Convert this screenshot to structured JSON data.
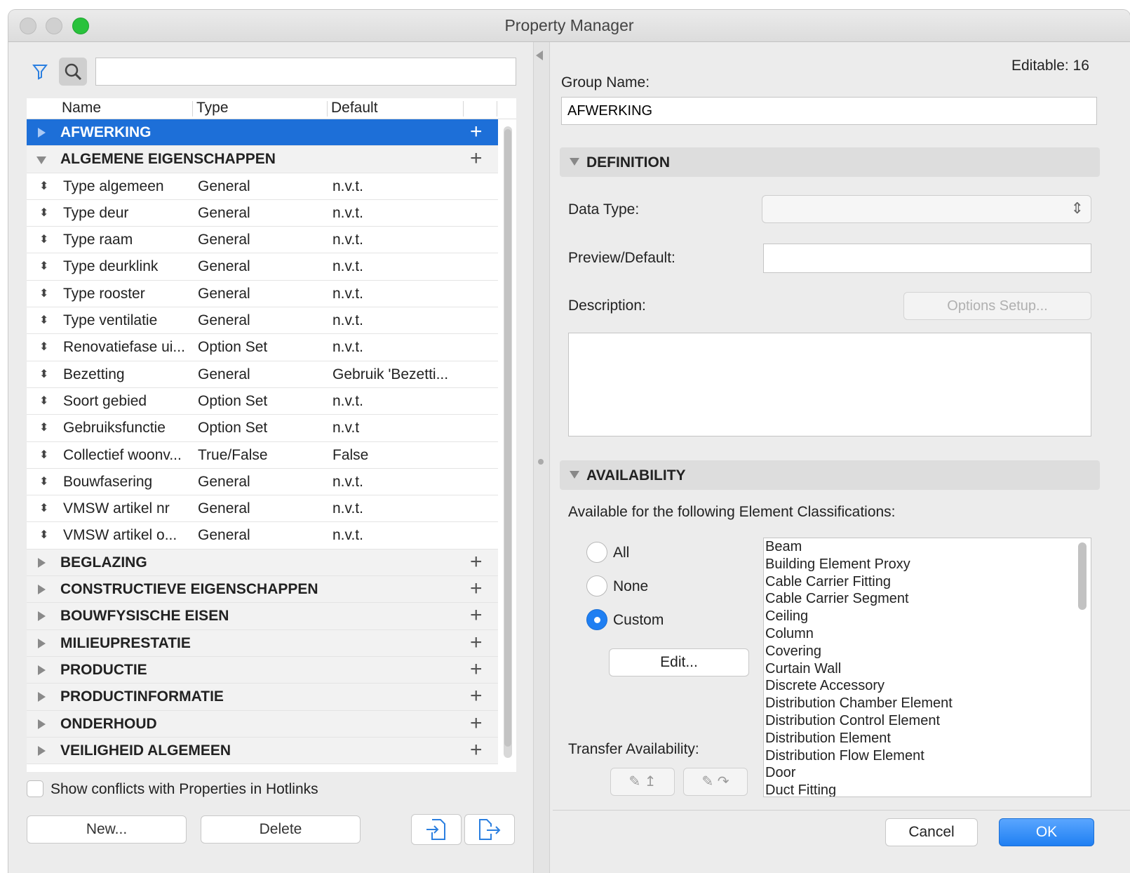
{
  "window": {
    "title": "Property Manager"
  },
  "left": {
    "search_value": "",
    "columns": [
      "Name",
      "Type",
      "Default"
    ],
    "groups_before": [
      {
        "name": "AFWERKING",
        "expanded": false,
        "selected": true
      },
      {
        "name": "ALGEMENE EIGENSCHAPPEN",
        "expanded": true,
        "selected": false
      }
    ],
    "properties": [
      {
        "name": "Type algemeen",
        "type": "General",
        "default": "n.v.t."
      },
      {
        "name": "Type deur",
        "type": "General",
        "default": "n.v.t."
      },
      {
        "name": "Type raam",
        "type": "General",
        "default": "n.v.t."
      },
      {
        "name": "Type deurklink",
        "type": "General",
        "default": "n.v.t."
      },
      {
        "name": "Type rooster",
        "type": "General",
        "default": "n.v.t."
      },
      {
        "name": "Type ventilatie",
        "type": "General",
        "default": "n.v.t."
      },
      {
        "name": "Renovatiefase ui...",
        "type": "Option Set",
        "default": "n.v.t."
      },
      {
        "name": "Bezetting",
        "type": "General",
        "default": "Gebruik 'Bezetti..."
      },
      {
        "name": "Soort gebied",
        "type": "Option Set",
        "default": "n.v.t."
      },
      {
        "name": "Gebruiksfunctie",
        "type": "Option Set",
        "default": "n.v.t"
      },
      {
        "name": "Collectief woonv...",
        "type": "True/False",
        "default": "False"
      },
      {
        "name": "Bouwfasering",
        "type": "General",
        "default": "n.v.t."
      },
      {
        "name": "VMSW artikel nr",
        "type": "General",
        "default": "n.v.t."
      },
      {
        "name": "VMSW artikel o...",
        "type": "General",
        "default": "n.v.t."
      }
    ],
    "groups_after": [
      {
        "name": "BEGLAZING"
      },
      {
        "name": "CONSTRUCTIEVE EIGENSCHAPPEN"
      },
      {
        "name": "BOUWFYSISCHE EISEN"
      },
      {
        "name": "MILIEUPRESTATIE"
      },
      {
        "name": "PRODUCTIE"
      },
      {
        "name": "PRODUCTINFORMATIE"
      },
      {
        "name": "ONDERHOUD"
      },
      {
        "name": "VEILIGHEID ALGEMEEN"
      }
    ],
    "show_conflicts_label": "Show conflicts with Properties in Hotlinks",
    "new_label": "New...",
    "delete_label": "Delete"
  },
  "right": {
    "editable_label": "Editable: 16",
    "group_name_label": "Group Name:",
    "group_name_value": "AFWERKING",
    "definition_title": "DEFINITION",
    "data_type_label": "Data Type:",
    "preview_label": "Preview/Default:",
    "description_label": "Description:",
    "options_setup_label": "Options Setup...",
    "availability_title": "AVAILABILITY",
    "available_for_label": "Available for the following Element Classifications:",
    "radio_all": "All",
    "radio_none": "None",
    "radio_custom": "Custom",
    "edit_label": "Edit...",
    "transfer_label": "Transfer Availability:",
    "classifications": [
      "Beam",
      "Building Element Proxy",
      "Cable Carrier Fitting",
      "Cable Carrier Segment",
      "Ceiling",
      "Column",
      "Covering",
      "Curtain Wall",
      "Discrete Accessory",
      "Distribution Chamber Element",
      "Distribution Control Element",
      "Distribution Element",
      "Distribution Flow Element",
      "Door",
      "Duct Fitting"
    ],
    "cancel_label": "Cancel",
    "ok_label": "OK"
  },
  "colors": {
    "accent": "#1d6fd8",
    "ok_button": "#1f7ff2",
    "traffic_green": "#29c23c"
  }
}
